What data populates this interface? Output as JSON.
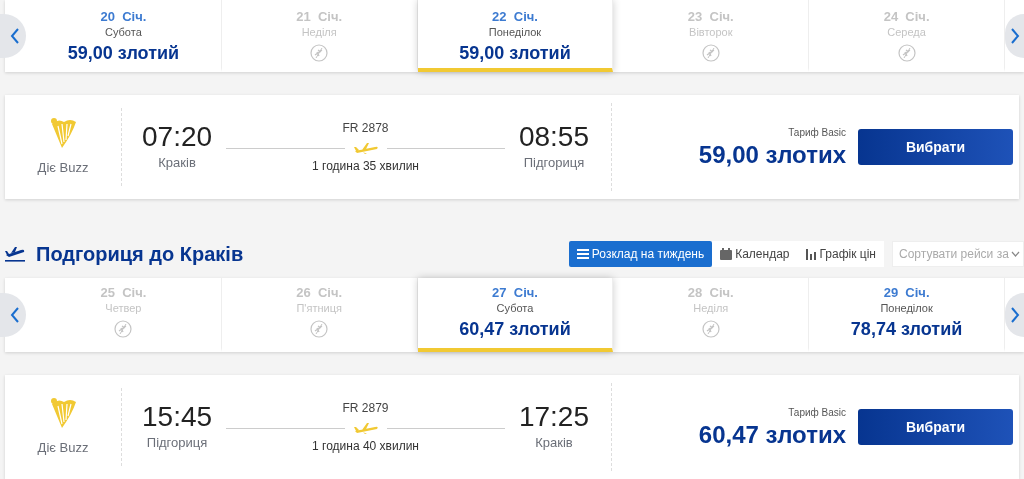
{
  "sections": [
    {
      "dates": [
        {
          "date": "20  Січ.",
          "weekday": "Субота",
          "available": true,
          "price": "59,00 злотий",
          "selected": false
        },
        {
          "date": "21  Січ.",
          "weekday": "Неділя",
          "available": false,
          "selected": false
        },
        {
          "date": "22  Січ.",
          "weekday": "Понеділок",
          "available": true,
          "price": "59,00 злотий",
          "selected": true
        },
        {
          "date": "23  Січ.",
          "weekday": "Вівторок",
          "available": false,
          "selected": false
        },
        {
          "date": "24  Січ.",
          "weekday": "Середа",
          "available": false,
          "selected": false
        }
      ],
      "flight": {
        "airline": "Діє Buzz",
        "departure_time": "07:20",
        "departure_city": "Краків",
        "flight_number": "FR 2878",
        "duration": "1 година 35 хвилин",
        "arrival_time": "08:55",
        "arrival_city": "Підгориця",
        "fare": "Тариф Basic",
        "price": "59,00 злотих",
        "button": "Вибрати"
      }
    },
    {
      "title": "Подгориця до Краків",
      "views": [
        {
          "kind": "list",
          "label": "Розклад на тиждень",
          "selected": true
        },
        {
          "kind": "calendar",
          "label": "Календар",
          "selected": false
        },
        {
          "kind": "chart",
          "label": "Графік цін",
          "selected": false
        }
      ],
      "sort": {
        "placeholder": "Сортувати рейси за"
      },
      "dates": [
        {
          "date": "25  Січ.",
          "weekday": "Четвер",
          "available": false,
          "selected": false
        },
        {
          "date": "26  Січ.",
          "weekday": "П'ятниця",
          "available": false,
          "selected": false
        },
        {
          "date": "27  Січ.",
          "weekday": "Субота",
          "available": true,
          "price": "60,47 злотий",
          "selected": true
        },
        {
          "date": "28  Січ.",
          "weekday": "Неділя",
          "available": false,
          "selected": false
        },
        {
          "date": "29  Січ.",
          "weekday": "Понеділок",
          "available": true,
          "price": "78,74 злотий",
          "selected": false
        }
      ],
      "flight": {
        "airline": "Діє Buzz",
        "departure_time": "15:45",
        "departure_city": "Підгориця",
        "flight_number": "FR 2879",
        "duration": "1 година 40 хвилин",
        "arrival_time": "17:25",
        "arrival_city": "Краків",
        "fare": "Тариф Basic",
        "price": "60,47 злотих",
        "button": "Вибрати"
      }
    }
  ]
}
